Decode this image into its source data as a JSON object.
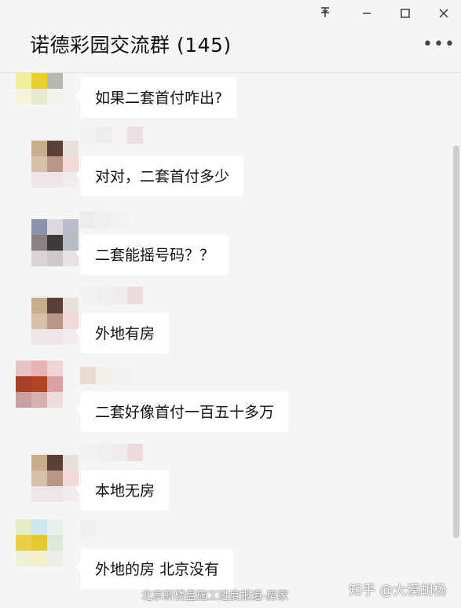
{
  "window": {
    "pin_icon": "pin-icon",
    "minimize_icon": "minimize-icon",
    "maximize_icon": "maximize-icon",
    "close_icon": "close-icon"
  },
  "header": {
    "title": "诺德彩园交流群 (145)",
    "more_icon": "more-icon"
  },
  "messages": [
    {
      "text": "如果二套首付咋出?"
    },
    {
      "text": "对对，二套首付多少"
    },
    {
      "text": "二套能摇号码？？"
    },
    {
      "text": "外地有房"
    },
    {
      "text": "二套好像首付一百五十多万"
    },
    {
      "text": "本地无房"
    },
    {
      "text": "外地的房 北京没有"
    }
  ],
  "watermarks": {
    "left": "北京新楼盘施工进度报道-房家",
    "right": "知乎 @大漠胡杨"
  }
}
